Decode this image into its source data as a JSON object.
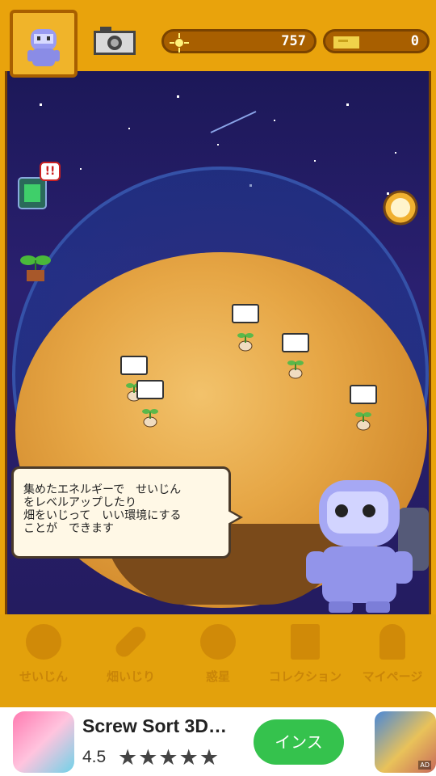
{
  "topbar": {
    "energy_value": "757",
    "ticket_value": "0",
    "icons": [
      "player-avatar-icon",
      "camera-icon",
      "energy-sun-icon",
      "ticket-icon"
    ]
  },
  "speech": {
    "text": "集めたエネルギーで　せいじん\nをレベルアップしたり\n畑をいじって　いい環境にする\nことが　できます"
  },
  "nav": {
    "items": [
      {
        "label": "せいじん",
        "icon": "seijin-icon"
      },
      {
        "label": "畑いじり",
        "icon": "carrot-icon"
      },
      {
        "label": "惑星",
        "icon": "planet-icon"
      },
      {
        "label": "コレクション",
        "icon": "book-icon"
      },
      {
        "label": "マイページ",
        "icon": "person-icon"
      }
    ]
  },
  "side": {
    "alert_badge": "!!"
  },
  "ad": {
    "title": "Screw Sort 3D…",
    "rating": "4.5",
    "stars": "★★★★★",
    "install_label": "インス",
    "badge": "AD"
  },
  "colors": {
    "bar": "#e9a30c",
    "space": "#231c66",
    "planet": "#e6a645",
    "install": "#35c24d"
  }
}
